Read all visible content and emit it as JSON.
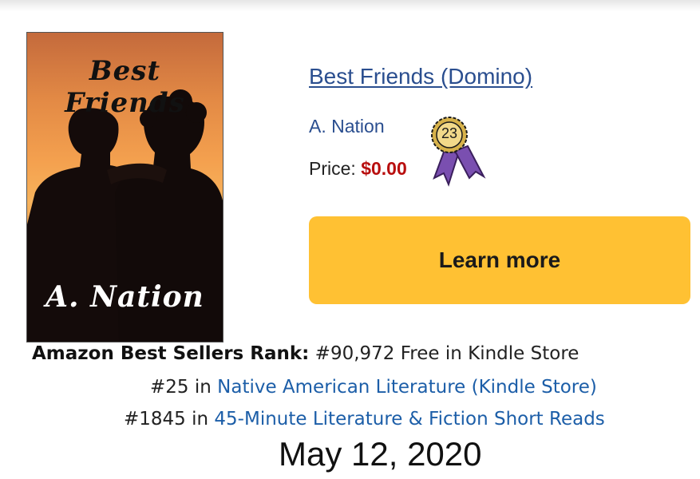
{
  "book": {
    "cover_title": "Best Friends",
    "cover_author": "A. Nation",
    "title": "Best Friends (Domino)",
    "author": "A. Nation",
    "price_label": "Price:",
    "price_value": "$0.00",
    "badge_number": "23"
  },
  "actions": {
    "learn_more_label": "Learn more",
    "button_color": "#ffc133"
  },
  "rank": {
    "label": "Amazon Best Sellers Rank:",
    "main": "#90,972 Free in Kindle Store",
    "entries": [
      {
        "position": "#25 in",
        "category": "Native American Literature (Kindle Store)"
      },
      {
        "position": "#1845 in",
        "category": "45-Minute Literature & Fiction Short Reads"
      }
    ]
  },
  "date": "May 12, 2020",
  "colors": {
    "link": "#2a4e8f",
    "price": "#b80e0e",
    "ribbon": "#7a4fb0",
    "medal": "#d7b24a"
  }
}
